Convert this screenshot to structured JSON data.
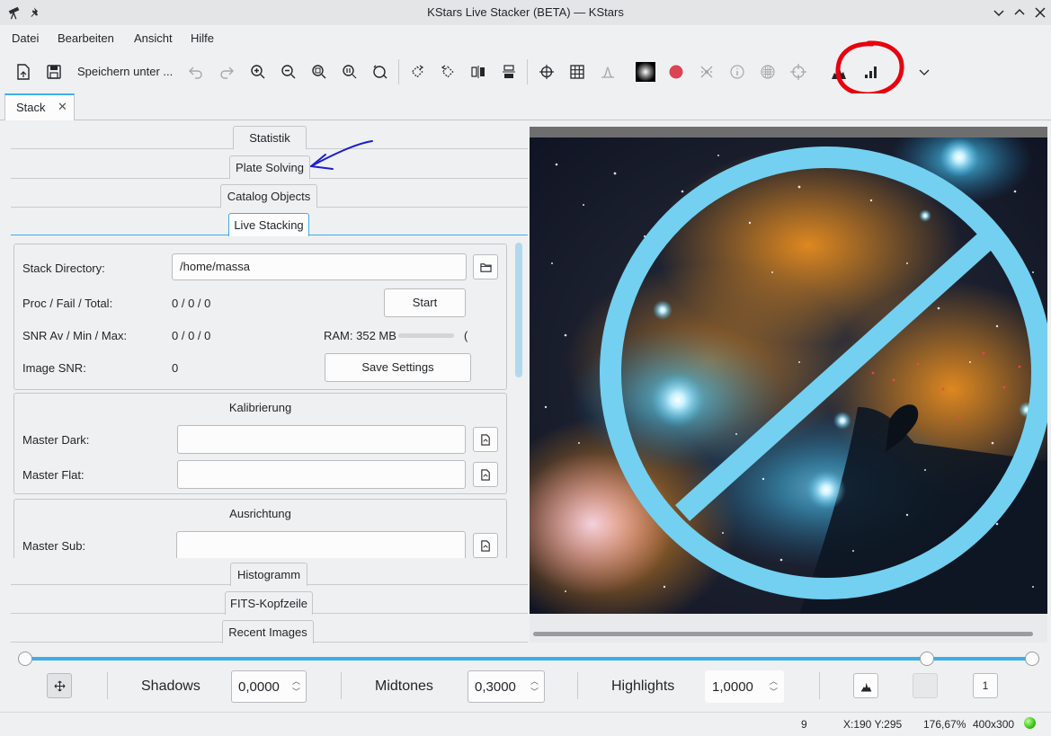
{
  "window": {
    "title": "KStars Live Stacker (BETA) — KStars"
  },
  "menu": [
    "Datei",
    "Bearbeiten",
    "Ansicht",
    "Hilfe"
  ],
  "toolbar": {
    "save_as_label": "Speichern unter ..."
  },
  "tabs": {
    "stack_label": "Stack"
  },
  "sections": {
    "statistics": "Statistik",
    "plate_solving": "Plate Solving",
    "catalog_objects": "Catalog Objects",
    "live_stacking": "Live Stacking",
    "histogram": "Histogramm",
    "fits_header": "FITS-Kopfzeile",
    "recent_images": "Recent Images"
  },
  "live": {
    "stack_directory_label": "Stack Directory:",
    "stack_directory_value": "/home/massa",
    "proc_label": "Proc / Fail / Total:",
    "proc_value": "0 / 0 / 0",
    "start_button": "Start",
    "snr_label": "SNR Av / Min / Max:",
    "snr_value": "0 / 0 / 0",
    "ram_label": "RAM: 352 MB",
    "ram_fraction": 0,
    "ram_suffix": "(",
    "image_snr_label": "Image SNR:",
    "image_snr_value": "0",
    "save_settings_button": "Save Settings",
    "calibration_title": "Kalibrierung",
    "master_dark_label": "Master Dark:",
    "master_dark_value": "",
    "master_flat_label": "Master Flat:",
    "master_flat_value": "",
    "alignment_title": "Ausrichtung",
    "master_sub_label": "Master Sub:",
    "master_sub_value": ""
  },
  "stretch": {
    "shadows_label": "Shadows",
    "shadows_value": "0,0000",
    "midtones_label": "Midtones",
    "midtones_value": "0,3000",
    "highlights_label": "Highlights",
    "highlights_value": "1,0000",
    "number_button": "1"
  },
  "status": {
    "count": "9",
    "coords": "X:190 Y:295",
    "zoom": "176,67%",
    "size": "400x300"
  },
  "colors": {
    "accent": "#3daee9",
    "annotation_red": "#e8000e",
    "annotation_blue": "#1c1ccf",
    "record_red": "#da4453",
    "status_green": "#2db800"
  }
}
